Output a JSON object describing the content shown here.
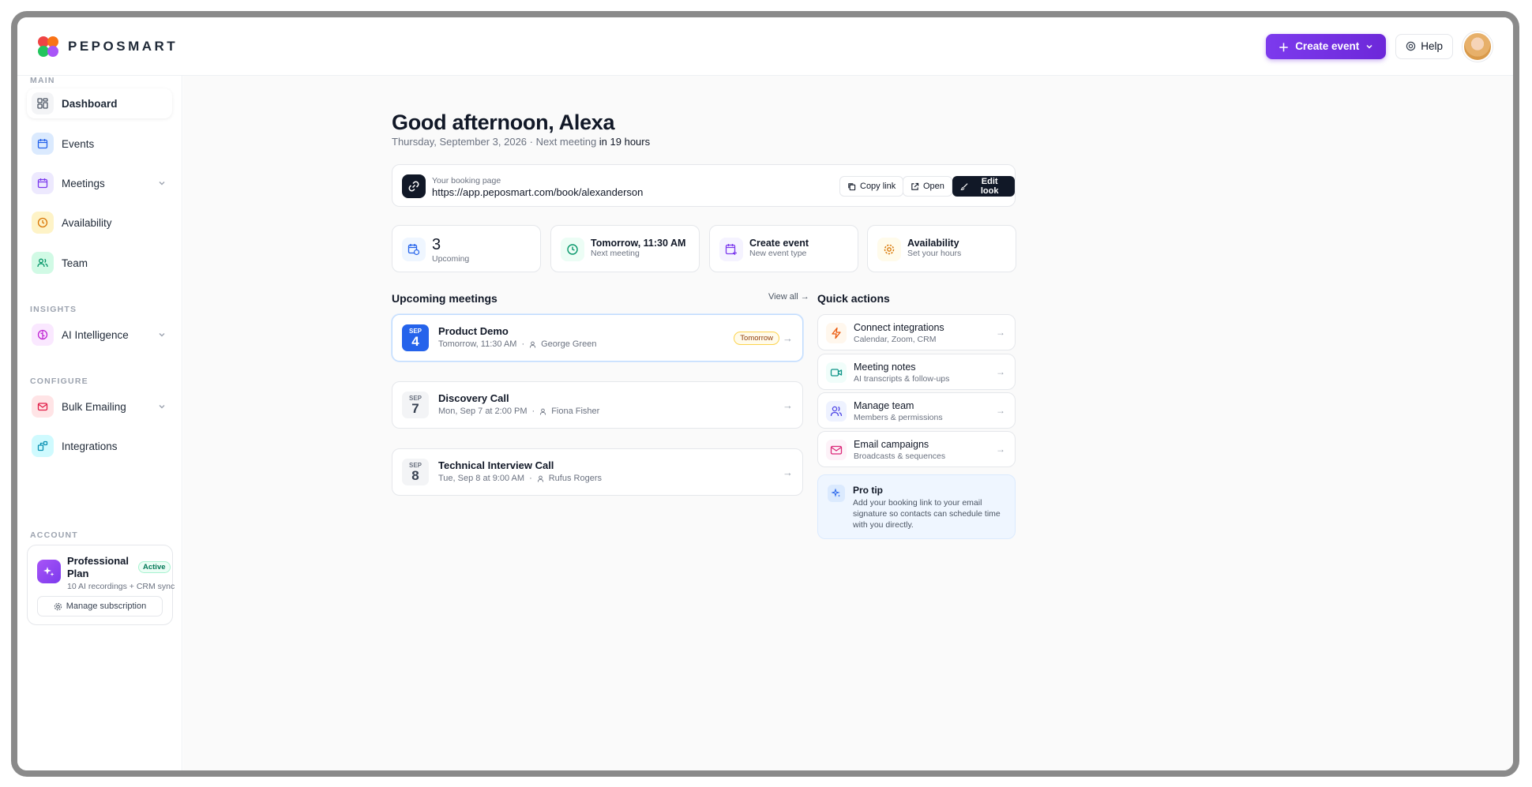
{
  "brand": {
    "name": "PEPOSMART"
  },
  "header": {
    "create_label": "Create event",
    "help_label": "Help"
  },
  "sidebar": {
    "sections": {
      "main": "MAIN",
      "insights": "INSIGHTS",
      "configure": "CONFIGURE",
      "account": "ACCOUNT"
    },
    "items": [
      {
        "label": "Dashboard"
      },
      {
        "label": "Events"
      },
      {
        "label": "Meetings"
      },
      {
        "label": "Availability"
      },
      {
        "label": "Team"
      },
      {
        "label": "AI Intelligence"
      },
      {
        "label": "Bulk Emailing"
      },
      {
        "label": "Integrations"
      }
    ],
    "plan": {
      "title": "Professional Plan",
      "badge": "Active",
      "subtitle": "10 AI recordings + CRM sync",
      "button": "Manage subscription"
    }
  },
  "main": {
    "greeting": "Good afternoon, Alexa",
    "date_line": "Thursday, September 3, 2026 · Next meeting ",
    "date_line_em": "in 19 hours",
    "booking": {
      "label": "Your booking page",
      "url": "https://app.peposmart.com/book/alexanderson",
      "copy": "Copy link",
      "open": "Open",
      "edit": "Edit look"
    },
    "stats": [
      {
        "value": "3",
        "sub": "Upcoming"
      },
      {
        "title": "Tomorrow, 11:30 AM",
        "sub": "Next meeting"
      },
      {
        "title": "Create event",
        "sub": "New event type"
      },
      {
        "title": "Availability",
        "sub": "Set your hours"
      }
    ],
    "upcoming_title": "Upcoming meetings",
    "view_all": "View all",
    "meetings": [
      {
        "month": "SEP",
        "day": "4",
        "title": "Product Demo",
        "time": "Tomorrow, 11:30 AM",
        "person": "George Green",
        "badge": "Tomorrow"
      },
      {
        "month": "SEP",
        "day": "7",
        "title": "Discovery Call",
        "time": "Mon, Sep 7 at 2:00 PM",
        "person": "Fiona Fisher"
      },
      {
        "month": "SEP",
        "day": "8",
        "title": "Technical Interview Call",
        "time": "Tue, Sep 8 at 9:00 AM",
        "person": "Rufus Rogers"
      }
    ],
    "quick_title": "Quick actions",
    "quick": [
      {
        "title": "Connect integrations",
        "sub": "Calendar, Zoom, CRM"
      },
      {
        "title": "Meeting notes",
        "sub": "AI transcripts & follow-ups"
      },
      {
        "title": "Manage team",
        "sub": "Members & permissions"
      },
      {
        "title": "Email campaigns",
        "sub": "Broadcasts & sequences"
      }
    ],
    "tip": {
      "title": "Pro tip",
      "body": "Add your booking link to your email signature so contacts can schedule time with you directly."
    }
  }
}
